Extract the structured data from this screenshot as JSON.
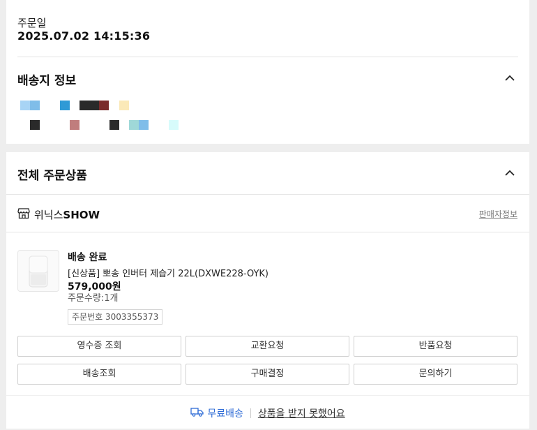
{
  "order_date": {
    "label": "주문일",
    "value": "2025.07.02 14:15:36"
  },
  "shipping_info": {
    "title": "배송지 정보",
    "colors": {
      "light_blue": "#a8d4f5",
      "blue": "#2f9ad6",
      "dark": "#2a2a2a",
      "maroon": "#7a2b2b",
      "cream": "#fbe9b8",
      "rose": "#c07d7d",
      "teal": "#9fd8d8",
      "mint": "#d7fbfb"
    }
  },
  "order_items": {
    "title": "전체 주문상품",
    "store": {
      "name_prefix": "위닉스",
      "name_suffix": "SHOW",
      "seller_info_link": "판매자정보"
    },
    "product": {
      "status": "배송 완료",
      "name": "[신상품] 뽀송 인버터 제습기 22L(DXWE228-OYK)",
      "price": "579,000원",
      "quantity": "주문수량:1개",
      "order_number": "주문번호 3003355373"
    },
    "buttons": {
      "receipt": "영수증 조회",
      "exchange": "교환요청",
      "return": "반품요청",
      "tracking": "배송조회",
      "confirm": "구매결정",
      "inquiry": "문의하기"
    },
    "footer": {
      "free_shipping": "무료배송",
      "not_received": "상품을 받지 못했어요"
    }
  }
}
